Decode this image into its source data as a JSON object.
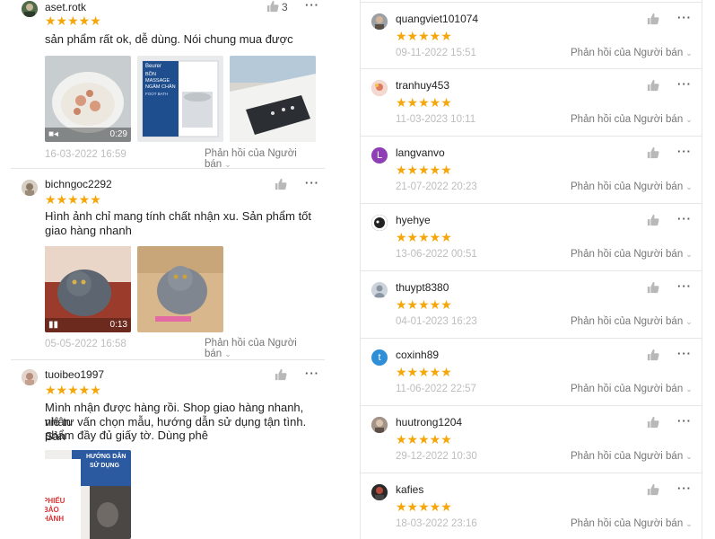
{
  "left": {
    "reviews": [
      {
        "user": "aset.rotk",
        "stars": "★★★★★",
        "likes": "3",
        "text": "sản phẩm rất ok, dễ dùng. Nói chung mua được",
        "date": "16-03-2022 16:59",
        "reply": "Phản hồi của Người bán",
        "media": [
          {
            "duration": "0:29"
          },
          {
            "label1": "Beurer",
            "label2": "BỒN MASSAGE NGÂM CHÂN",
            "label3": "FOOT BATH"
          },
          {}
        ]
      },
      {
        "user": "bichngoc2292",
        "stars": "★★★★★",
        "text1": "Hình ảnh chỉ mang tính chất nhận xu. Sản phẩm tốt",
        "text2": "giao hàng nhanh",
        "date": "05-05-2022 16:58",
        "reply": "Phản hồi của Người bán",
        "media": [
          {
            "duration": "0:13"
          },
          {}
        ]
      },
      {
        "user": "tuoibeo1997",
        "stars": "★★★★★",
        "text1": "Mình nhận được hàng rồi. Shop giao hàng nhanh, nhân",
        "text2": "viê tư vấn chọn mẫu, hướng dẫn sử dụng tận tình. Sản",
        "text3": "phẩm đầy đủ giấy tờ. Dùng phê",
        "media": [
          {
            "label1": "HƯỚNG DẪN",
            "label2": "SỬ DỤNG",
            "label3": "PHIẾU BẢO HÀNH"
          }
        ]
      }
    ]
  },
  "right": {
    "reviews": [
      {
        "user": "quangviet101074",
        "stars": "★★★★★",
        "date": "09-11-2022 15:51",
        "reply": "Phản hồi của Người bán",
        "avatar": "photo"
      },
      {
        "user": "tranhuy453",
        "stars": "★★★★★",
        "date": "11-03-2023 10:11",
        "reply": "Phản hồi của Người bán",
        "avatar": "photo"
      },
      {
        "user": "langvanvo",
        "stars": "★★★★★",
        "date": "21-07-2022 20:23",
        "reply": "Phản hồi của Người bán",
        "avatar": "L"
      },
      {
        "user": "hyehye",
        "stars": "★★★★★",
        "date": "13-06-2022 00:51",
        "reply": "Phản hồi của Người bán",
        "avatar": "photo"
      },
      {
        "user": "thuypt8380",
        "stars": "★★★★★",
        "date": "04-01-2023 16:23",
        "reply": "Phản hồi của Người bán",
        "avatar": "default"
      },
      {
        "user": "coxinh89",
        "stars": "★★★★★",
        "date": "11-06-2022 22:57",
        "reply": "Phản hồi của Người bán",
        "avatar": "t"
      },
      {
        "user": "huutrong1204",
        "stars": "★★★★★",
        "date": "29-12-2022 10:30",
        "reply": "Phản hồi của Người bán",
        "avatar": "photo"
      },
      {
        "user": "kafies",
        "stars": "★★★★★",
        "date": "18-03-2022 23:16",
        "reply": "Phản hồi của Người bán",
        "avatar": "photo"
      }
    ]
  },
  "colors": {
    "star": "#f6a609",
    "langvanvo_avatar": "#8e3fb5",
    "coxinh89_avatar": "#2f8fd6",
    "date": "#bdbdbd"
  },
  "icons": {
    "like": "thumbs-up-icon",
    "more": "more-dots-icon",
    "reply_chevron": "chevron-down-icon",
    "video": "video-camera-icon"
  }
}
